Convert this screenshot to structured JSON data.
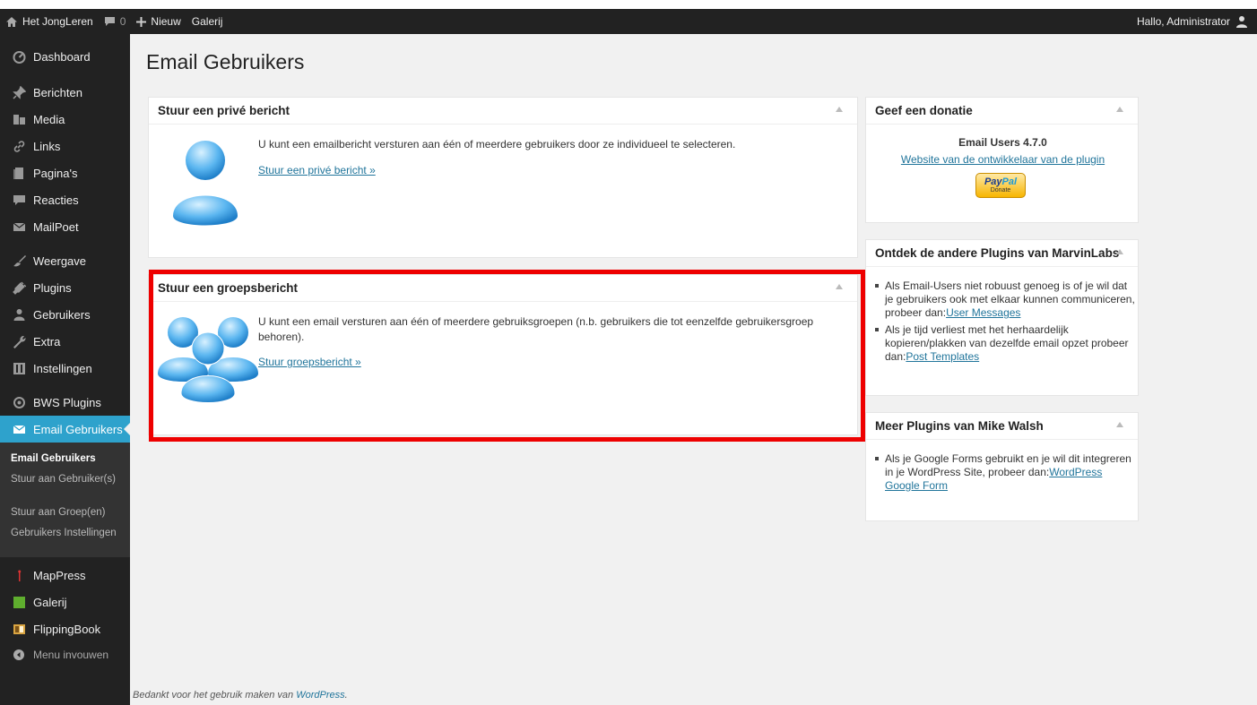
{
  "adminbar": {
    "site_name": "Het JongLeren",
    "comments_count": "0",
    "new_label": "Nieuw",
    "gallery_label": "Galerij",
    "greeting": "Hallo, Administrator"
  },
  "sidebar": {
    "items": [
      {
        "label": "Dashboard",
        "icon": "dashboard-icon"
      },
      {
        "label": "Berichten",
        "icon": "pin-icon"
      },
      {
        "label": "Media",
        "icon": "media-icon"
      },
      {
        "label": "Links",
        "icon": "link-icon"
      },
      {
        "label": "Pagina's",
        "icon": "page-icon"
      },
      {
        "label": "Reacties",
        "icon": "comment-icon"
      },
      {
        "label": "MailPoet",
        "icon": "mail-icon"
      },
      {
        "label": "Weergave",
        "icon": "brush-icon"
      },
      {
        "label": "Plugins",
        "icon": "plugin-icon"
      },
      {
        "label": "Gebruikers",
        "icon": "users-icon"
      },
      {
        "label": "Extra",
        "icon": "wrench-icon"
      },
      {
        "label": "Instellingen",
        "icon": "settings-icon"
      },
      {
        "label": "BWS Plugins",
        "icon": "bws-icon"
      },
      {
        "label": "Email Gebruikers",
        "icon": "envelope-icon"
      },
      {
        "label": "MapPress",
        "icon": "map-pin-icon"
      },
      {
        "label": "Galerij",
        "icon": "gallery-icon"
      },
      {
        "label": "FlippingBook",
        "icon": "book-icon"
      },
      {
        "label": "Menu invouwen",
        "icon": "collapse-icon"
      }
    ],
    "submenu": [
      {
        "label": "Email Gebruikers"
      },
      {
        "label": "Stuur aan Gebruiker(s)"
      },
      {
        "label": "Stuur aan Groep(en)"
      },
      {
        "label": "Gebruikers Instellingen"
      }
    ]
  },
  "main": {
    "title": "Email Gebruikers",
    "private_box": {
      "title": "Stuur een privé bericht",
      "text": "U kunt een emailbericht versturen aan één of meerdere gebruikers door ze individueel te selecteren.",
      "link": "Stuur een privé bericht »"
    },
    "group_box": {
      "title": "Stuur een groepsbericht",
      "text": "U kunt een email versturen aan één of meerdere gebruiksgroepen (n.b. gebruikers die tot eenzelfde gebruikersgroep behoren).",
      "link": "Stuur groepsbericht »"
    },
    "donate_box": {
      "title": "Geef een donatie",
      "version": "Email Users 4.7.0",
      "dev_link": "Website van de ontwikkelaar van de plugin",
      "paypal_pay": "Pay",
      "paypal_pal": "Pal",
      "paypal_donate": "Donate"
    },
    "marvin_box": {
      "title": "Ontdek de andere Plugins van MarvinLabs",
      "item1_text": "Als Email-Users niet robuust genoeg is of je wil dat je gebruikers ook met elkaar kunnen communiceren, probeer dan:",
      "item1_link": "User Messages",
      "item2_text": "Als je tijd verliest met het herhaardelijk kopieren/plakken van dezelfde email opzet probeer dan:",
      "item2_link": "Post Templates"
    },
    "walsh_box": {
      "title": "Meer Plugins van Mike Walsh",
      "item1_text": "Als je Google Forms gebruikt en je wil dit integreren in je WordPress Site, probeer dan:",
      "item1_link": "WordPress Google Form"
    }
  },
  "footer": {
    "text": "Bedankt voor het gebruik maken van ",
    "link": "WordPress",
    "end": "."
  },
  "colors": {
    "accent": "#2ea2cc",
    "highlight": "#e00000",
    "link": "#21759b"
  }
}
